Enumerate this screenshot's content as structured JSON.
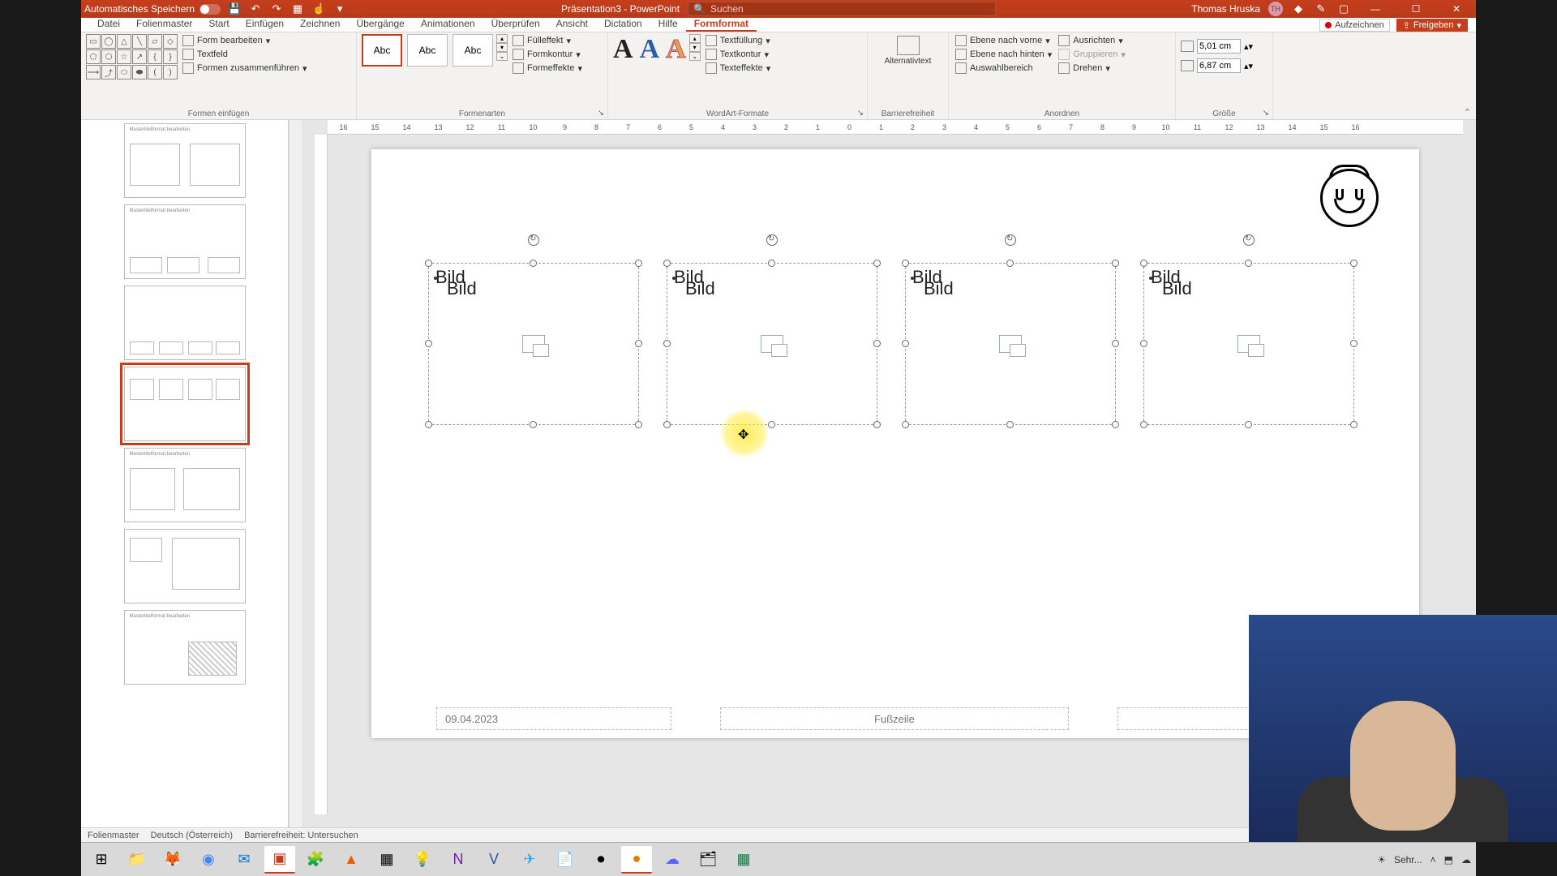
{
  "titlebar": {
    "autosave": "Automatisches Speichern",
    "doc": "Präsentation3",
    "app": "PowerPoint",
    "search_placeholder": "Suchen",
    "user": "Thomas Hruska",
    "initials": "TH"
  },
  "tabs": {
    "items": [
      "Datei",
      "Folienmaster",
      "Start",
      "Einfügen",
      "Zeichnen",
      "Übergänge",
      "Animationen",
      "Überprüfen",
      "Ansicht",
      "Dictation",
      "Hilfe",
      "Formformat"
    ],
    "active": "Formformat",
    "record": "Aufzeichnen",
    "share": "Freigeben"
  },
  "ribbon": {
    "g_insert": "Formen einfügen",
    "edit_shape": "Form bearbeiten",
    "textbox": "Textfeld",
    "merge": "Formen zusammenführen",
    "g_styles": "Formenarten",
    "style_sample": "Abc",
    "fill": "Fülleffekt",
    "outline": "Formkontur",
    "effects": "Formeffekte",
    "g_wordart": "WordArt-Formate",
    "textfill": "Textfüllung",
    "textoutline": "Textkontur",
    "texteffects": "Texteffekte",
    "g_acc": "Barrierefreiheit",
    "alttext": "Alternativtext",
    "g_arrange": "Anordnen",
    "front": "Ebene nach vorne",
    "back": "Ebene nach hinten",
    "selpane": "Auswahlbereich",
    "align": "Ausrichten",
    "group": "Gruppieren",
    "rotate": "Drehen",
    "g_size": "Größe",
    "height": "5,01 cm",
    "width": "6,87 cm"
  },
  "ruler": [
    "16",
    "15",
    "14",
    "13",
    "12",
    "11",
    "10",
    "9",
    "8",
    "7",
    "6",
    "5",
    "4",
    "3",
    "2",
    "1",
    "0",
    "1",
    "2",
    "3",
    "4",
    "5",
    "6",
    "7",
    "8",
    "9",
    "10",
    "11",
    "12",
    "13",
    "14",
    "15",
    "16"
  ],
  "slide": {
    "ph_label1": "Bild",
    "ph_label2": "Bild",
    "date": "09.04.2023",
    "footer": "Fußzeile"
  },
  "status": {
    "mode": "Folienmaster",
    "lang": "Deutsch (Österreich)",
    "acc": "Barrierefreiheit: Untersuchen"
  },
  "tray": {
    "weather": "Sehr..."
  }
}
